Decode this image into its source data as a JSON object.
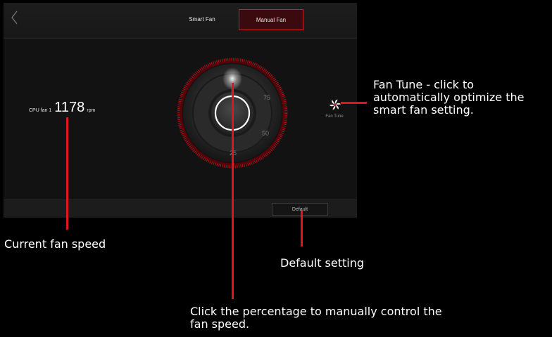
{
  "header": {
    "tabs": [
      {
        "label": "Smart Fan",
        "selected": false
      },
      {
        "label": "Manual Fan",
        "selected": true
      }
    ]
  },
  "fan_readout": {
    "label": "CPU fan 1",
    "value": "1178",
    "unit": "rpm"
  },
  "dial": {
    "tick_labels": [
      "75",
      "50",
      "25"
    ]
  },
  "fan_tune": {
    "label": "Fan Tune"
  },
  "footer": {
    "default_label": "Default"
  },
  "callouts": {
    "fan_tune": "Fan Tune - click to\nautomatically optimize the\nsmart fan setting.",
    "current_speed": "Current fan speed",
    "default_setting": "Default setting",
    "percentage": "Click the percentage to manually control the\nfan speed."
  },
  "colors": {
    "accent": "#e2141f",
    "tab_selected_bg": "#3b0a0e",
    "panel_bg": "#121212"
  },
  "icons": [
    "back-chevron-icon",
    "fan-icon"
  ]
}
